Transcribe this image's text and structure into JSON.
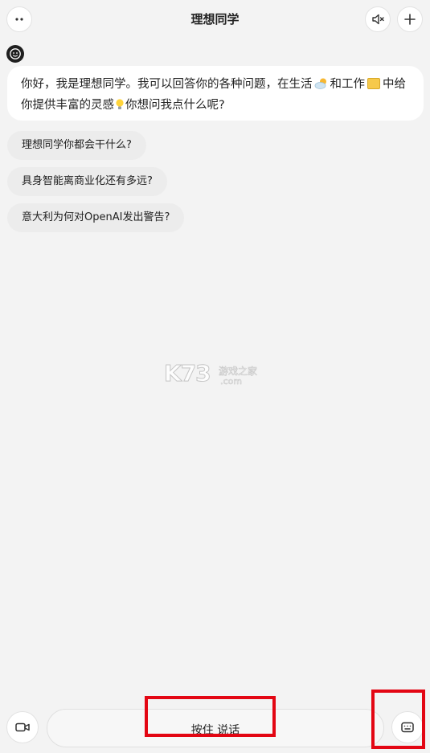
{
  "header": {
    "title": "理想同学",
    "icons": [
      "dots-icon",
      "mute-icon",
      "plus-icon"
    ]
  },
  "avatar": {
    "icon": "robot-face-icon"
  },
  "greeting": {
    "part1": "你好，我是理想同学。我可以回答你的各种问题，在生活",
    "part2": "和工作",
    "part3": "中给你提供丰富的灵感",
    "part4": "你想问我点什么呢?",
    "emojis": [
      "cloud-sun-icon",
      "note-icon",
      "bulb-icon"
    ]
  },
  "suggestions": [
    {
      "label": "理想同学你都会干什么?"
    },
    {
      "label": "具身智能离商业化还有多远?"
    },
    {
      "label": "意大利为何对OpenAI发出警告?"
    }
  ],
  "watermark": {
    "brand": "K73",
    "cn": "游戏之家",
    "domain": ".com"
  },
  "bottom_bar": {
    "talk_label": "按住 说话",
    "hint": "",
    "icons": [
      "video-camera-icon",
      "keyboard-icon"
    ]
  },
  "colors": {
    "background": "#f3f3f3",
    "bubble": "#ffffff",
    "suggestion": "#ececec",
    "highlight": "#e30613"
  }
}
